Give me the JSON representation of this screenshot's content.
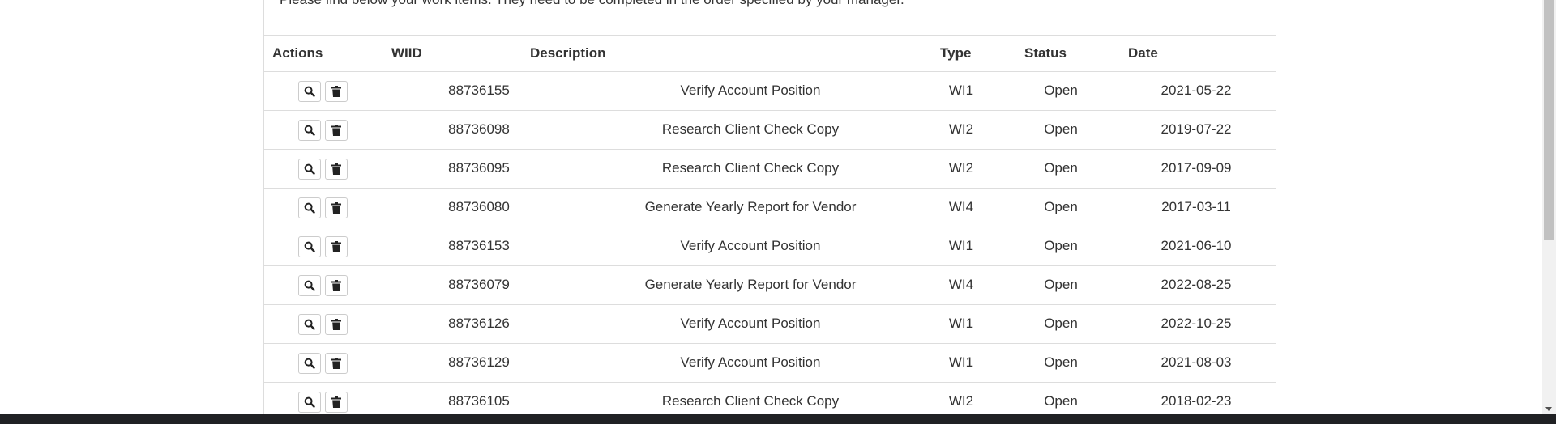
{
  "intro_text": "Please find below your work items. They need to be completed in the order specified by your manager.",
  "columns": {
    "actions": "Actions",
    "wiid": "WIID",
    "description": "Description",
    "type": "Type",
    "status": "Status",
    "date": "Date"
  },
  "icons": {
    "view": "search-icon",
    "delete": "trash-icon"
  },
  "rows": [
    {
      "wiid": "88736155",
      "description": "Verify Account Position",
      "type": "WI1",
      "status": "Open",
      "date": "2021-05-22"
    },
    {
      "wiid": "88736098",
      "description": "Research Client Check Copy",
      "type": "WI2",
      "status": "Open",
      "date": "2019-07-22"
    },
    {
      "wiid": "88736095",
      "description": "Research Client Check Copy",
      "type": "WI2",
      "status": "Open",
      "date": "2017-09-09"
    },
    {
      "wiid": "88736080",
      "description": "Generate Yearly Report for Vendor",
      "type": "WI4",
      "status": "Open",
      "date": "2017-03-11"
    },
    {
      "wiid": "88736153",
      "description": "Verify Account Position",
      "type": "WI1",
      "status": "Open",
      "date": "2021-06-10"
    },
    {
      "wiid": "88736079",
      "description": "Generate Yearly Report for Vendor",
      "type": "WI4",
      "status": "Open",
      "date": "2022-08-25"
    },
    {
      "wiid": "88736126",
      "description": "Verify Account Position",
      "type": "WI1",
      "status": "Open",
      "date": "2022-10-25"
    },
    {
      "wiid": "88736129",
      "description": "Verify Account Position",
      "type": "WI1",
      "status": "Open",
      "date": "2021-08-03"
    },
    {
      "wiid": "88736105",
      "description": "Research Client Check Copy",
      "type": "WI2",
      "status": "Open",
      "date": "2018-02-23"
    }
  ]
}
